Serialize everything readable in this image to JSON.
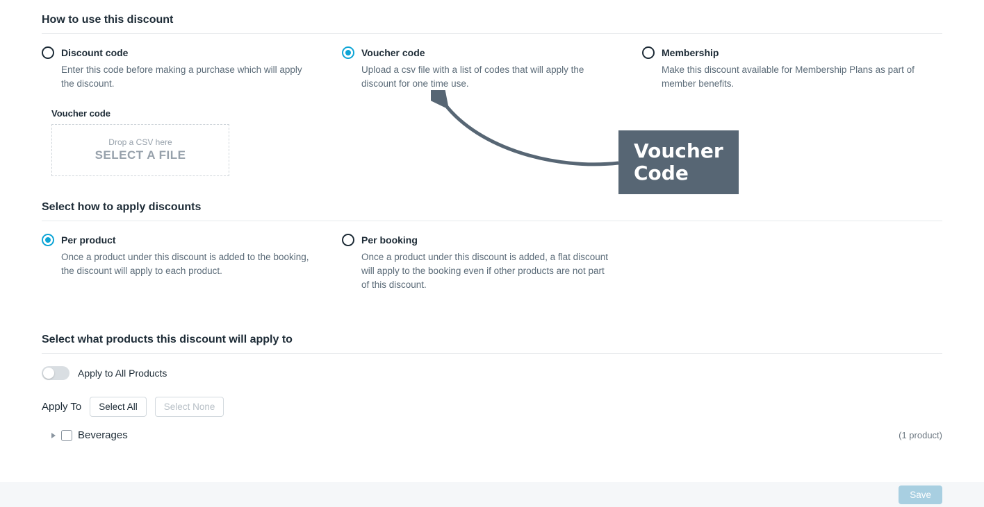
{
  "section1": {
    "title": "How to use this discount",
    "options": [
      {
        "label": "Discount code",
        "desc": "Enter this code before making a purchase which will apply the discount.",
        "selected": false
      },
      {
        "label": "Voucher code",
        "desc": "Upload a csv file with a list of codes that will apply the discount for one time use.",
        "selected": true
      },
      {
        "label": "Membership",
        "desc": "Make this discount available for Membership Plans as part of member benefits.",
        "selected": false
      }
    ],
    "upload": {
      "label": "Voucher code",
      "line1": "Drop a CSV here",
      "line2": "SELECT A FILE"
    }
  },
  "section2": {
    "title": "Select how to apply discounts",
    "options": [
      {
        "label": "Per product",
        "desc": "Once a product under this discount is added to the booking, the discount will apply to each product.",
        "selected": true
      },
      {
        "label": "Per booking",
        "desc": "Once a product under this discount is added, a flat discount will apply to the booking even if other products are not part of this discount.",
        "selected": false
      }
    ]
  },
  "section3": {
    "title": "Select what products this discount will apply to",
    "toggle_label": "Apply to All Products",
    "applyto_label": "Apply To",
    "select_all": "Select All",
    "select_none": "Select None",
    "tree": {
      "label": "Beverages",
      "count": "(1 product)"
    }
  },
  "callout": {
    "line1": "Voucher",
    "line2": "Code"
  },
  "footer": {
    "save": "Save"
  }
}
